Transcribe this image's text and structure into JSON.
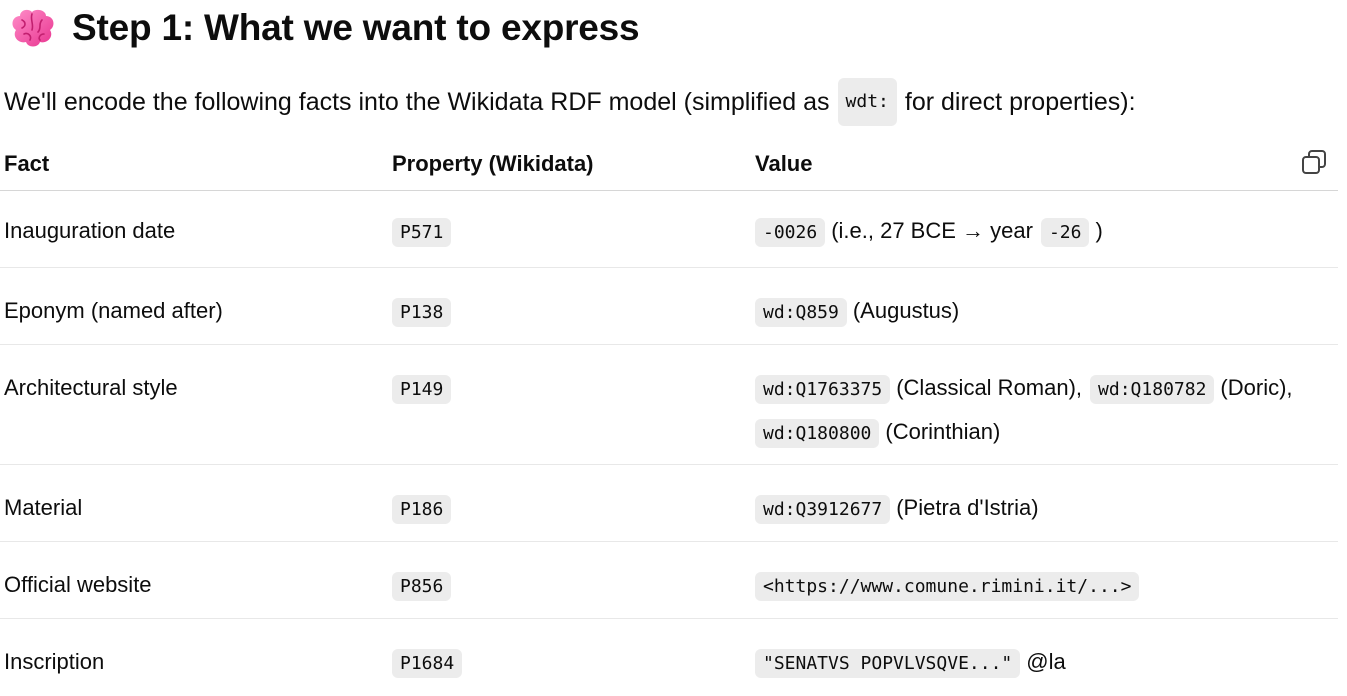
{
  "heading": {
    "icon": "brain-icon",
    "text": "Step 1: What we want to express"
  },
  "intro": {
    "before": "We'll encode the following facts into the Wikidata RDF model (simplified as",
    "code": "wdt:",
    "after": "for direct properties):"
  },
  "table": {
    "headers": {
      "fact": "Fact",
      "property": "Property (Wikidata)",
      "value": "Value"
    },
    "copy_icon": "copy-icon",
    "rows": [
      {
        "fact": "Inauguration date",
        "property": "P571",
        "value": {
          "code1": "-0026",
          "text1": "(i.e., 27 BCE → year",
          "code2": "-26",
          "text2": ")"
        }
      },
      {
        "fact": "Eponym (named after)",
        "property": "P138",
        "value": {
          "code1": "wd:Q859",
          "text1": "(Augustus)"
        }
      },
      {
        "fact": "Architectural style",
        "property": "P149",
        "value": {
          "code1": "wd:Q1763375",
          "text1": "(Classical Roman),",
          "code2": "wd:Q180782",
          "text2": "(Doric),",
          "code3": "wd:Q180800",
          "text3": "(Corinthian)"
        }
      },
      {
        "fact": "Material",
        "property": "P186",
        "value": {
          "code1": "wd:Q3912677",
          "text1": "(Pietra d'Istria)"
        }
      },
      {
        "fact": "Official website",
        "property": "P856",
        "value": {
          "code1": "<https://www.comune.rimini.it/...>"
        }
      },
      {
        "fact": "Inscription",
        "property": "P1684",
        "value": {
          "code1": "\"SENATVS POPVLVSQVE...\"",
          "text1": "@la"
        }
      }
    ]
  }
}
